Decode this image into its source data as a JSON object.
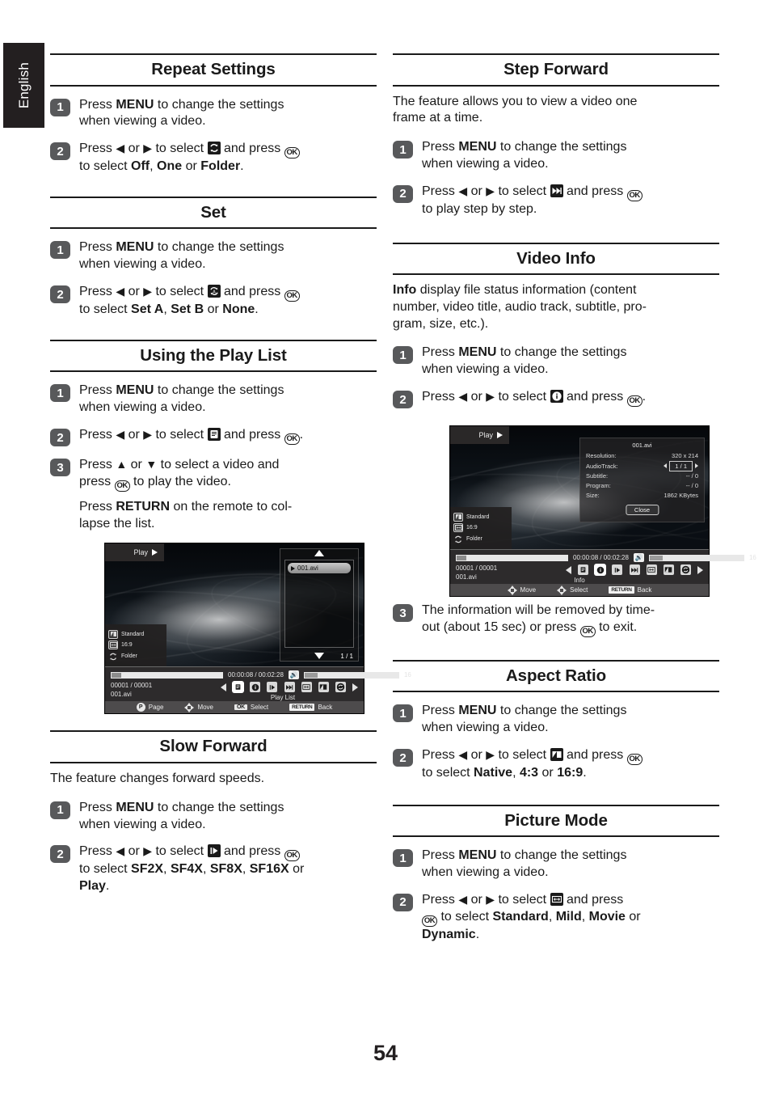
{
  "page": {
    "language_tab": "English",
    "page_number": "54"
  },
  "common": {
    "press_menu_line1_pre": "Press ",
    "press_menu_bold": "MENU",
    "press_menu_line1_post": " to change the settings",
    "press_menu_line2": "when viewing a video.",
    "press_word": "Press ",
    "arrow_left": "◀",
    "arrow_right": "▶",
    "arrow_up": "▲",
    "arrow_down": "▼",
    "or_word": " or ",
    "to_select": " to select ",
    "and_press": " and press ",
    "ok_label": "OK"
  },
  "sections": {
    "repeat_settings": {
      "title": "Repeat Settings",
      "step1_num": "1",
      "step2_num": "2",
      "step2_tail_pre": "to select ",
      "opt1": "Off",
      "opt2": "One",
      "opt3": "Folder",
      "icon": "repeat-icon"
    },
    "set": {
      "title": "Set",
      "step1_num": "1",
      "step2_num": "2",
      "opt1": "Set A",
      "opt2": "Set B",
      "opt3": "None",
      "icon": "ab-repeat-icon"
    },
    "using_play_list": {
      "title": "Using the Play List",
      "step1_num": "1",
      "step2_num": "2",
      "step3_num": "3",
      "step3_line1_a": "Press ",
      "step3_line1_b": " or ",
      "step3_line1_c": " to select a video and",
      "step3_line2_a": "press ",
      "step3_line2_b": " to play the video.",
      "step3_p2_a": "Press ",
      "step3_p2_bold": "RETURN",
      "step3_p2_b": " on the remote to col-",
      "step3_p2_c": "lapse the list.",
      "icon": "play-list-icon"
    },
    "slow_forward": {
      "title": "Slow Forward",
      "intro": "The feature changes forward speeds.",
      "step1_num": "1",
      "step2_num": "2",
      "opt1": "SF2X",
      "opt2": "SF4X",
      "opt3": "SF8X",
      "opt4": "SF16X",
      "opt5": "Play",
      "icon": "slow-forward-icon"
    },
    "step_forward": {
      "title": "Step Forward",
      "intro_line1": "The feature allows you to view a video one",
      "intro_line2": "frame at a time.",
      "step1_num": "1",
      "step2_num": "2",
      "step2_tail": "to play step by step.",
      "icon": "step-forward-icon"
    },
    "video_info": {
      "title": "Video Info",
      "intro_bold": "Info",
      "intro_line1": " display file status information (content",
      "intro_line2": "number, video title, audio track, subtitle, pro-",
      "intro_line3": "gram, size, etc.).",
      "step1_num": "1",
      "step2_num": "2",
      "step3_num": "3",
      "step3_line1": "The information will be removed by time-",
      "step3_line2_a": "out (about 15 sec) or press ",
      "step3_line2_b": " to exit.",
      "icon": "info-icon"
    },
    "aspect_ratio": {
      "title": "Aspect Ratio",
      "step1_num": "1",
      "step2_num": "2",
      "opt1": "Native",
      "opt2": "4:3",
      "opt3": "16:9",
      "icon": "aspect-ratio-icon"
    },
    "picture_mode": {
      "title": "Picture Mode",
      "step1_num": "1",
      "step2_num": "2",
      "step2_line2_a": " to select ",
      "opt1": "Standard",
      "opt2": "Mild",
      "opt3": "Movie",
      "opt4": "Dynamic",
      "icon": "picture-mode-icon"
    }
  },
  "tv_playlist": {
    "play_label": "Play",
    "osd": {
      "picture_mode": "Standard",
      "aspect": "16:9",
      "repeat": "Folder"
    },
    "panel": {
      "item": "001.avi",
      "page": "1 / 1"
    },
    "time": "00:00:08 / 00:02:28",
    "volume": "16",
    "content_number": "00001 / 00001",
    "file_name": "001.avi",
    "caption": "Play List",
    "hints": [
      {
        "key": "P",
        "label": "Page"
      },
      {
        "key": "dpad",
        "label": "Move"
      },
      {
        "key": "OK",
        "label": "Select"
      },
      {
        "key": "RETURN",
        "label": "Back"
      }
    ]
  },
  "tv_info": {
    "play_label": "Play",
    "osd": {
      "picture_mode": "Standard",
      "aspect": "16:9",
      "repeat": "Folder"
    },
    "info": {
      "title": "001.avi",
      "rows": [
        {
          "label": "Resolution:",
          "value": "320 x 214"
        },
        {
          "label": "AudioTrack:",
          "value": "1 / 1"
        },
        {
          "label": "Subtitle:",
          "value": "-- / 0"
        },
        {
          "label": "Program:",
          "value": "-- / 0"
        },
        {
          "label": "Size:",
          "value": "1862 KBytes"
        }
      ],
      "close_label": "Close"
    },
    "time": "00:00:08 / 00:02:28",
    "volume": "16",
    "content_number": "00001 / 00001",
    "file_name": "001.avi",
    "caption": "Info",
    "hints": [
      {
        "key": "dpad",
        "label": "Move"
      },
      {
        "key": "dpad",
        "label": "Select"
      },
      {
        "key": "RETURN",
        "label": "Back"
      }
    ]
  },
  "colors": {
    "text": "#1a1a1a",
    "step_badge": "#58595b",
    "tab_bg": "#231f20"
  }
}
